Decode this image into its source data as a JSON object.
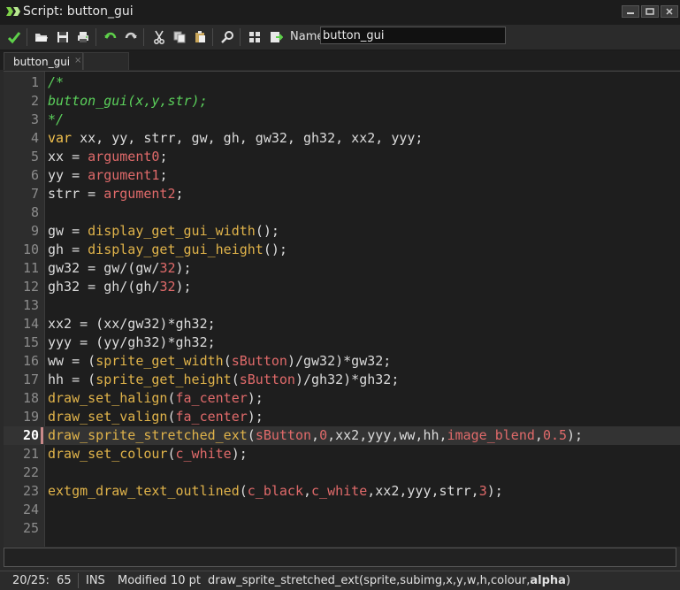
{
  "window": {
    "title": "Script: button_gui"
  },
  "toolbar": {
    "name_label": "Name",
    "name_value": "button_gui",
    "buttons": [
      "check-icon",
      "open-icon",
      "save-icon",
      "print-icon",
      "undo-icon",
      "redo-icon",
      "cut-icon",
      "copy-icon",
      "paste-icon",
      "find-icon",
      "goto-icon",
      "export-icon"
    ]
  },
  "tabs": [
    {
      "label": "button_gui",
      "close": "×"
    }
  ],
  "editor": {
    "current_line": 20,
    "lines": [
      {
        "n": "1",
        "tokens": [
          [
            "c",
            "/*"
          ]
        ]
      },
      {
        "n": "2",
        "tokens": [
          [
            "c",
            "button_gui(x,y,str);"
          ]
        ]
      },
      {
        "n": "3",
        "tokens": [
          [
            "c",
            "*/"
          ]
        ]
      },
      {
        "n": "4",
        "tokens": [
          [
            "k",
            "var"
          ],
          [
            "d",
            " xx, yy, strr, gw, gh, gw32, gh32, xx2, yyy;"
          ]
        ]
      },
      {
        "n": "5",
        "tokens": [
          [
            "d",
            "xx = "
          ],
          [
            "a",
            "argument0"
          ],
          [
            "d",
            ";"
          ]
        ]
      },
      {
        "n": "6",
        "tokens": [
          [
            "d",
            "yy = "
          ],
          [
            "a",
            "argument1"
          ],
          [
            "d",
            ";"
          ]
        ]
      },
      {
        "n": "7",
        "tokens": [
          [
            "d",
            "strr = "
          ],
          [
            "a",
            "argument2"
          ],
          [
            "d",
            ";"
          ]
        ]
      },
      {
        "n": "8",
        "tokens": []
      },
      {
        "n": "9",
        "tokens": [
          [
            "d",
            "gw = "
          ],
          [
            "f",
            "display_get_gui_width"
          ],
          [
            "d",
            "();"
          ]
        ]
      },
      {
        "n": "10",
        "tokens": [
          [
            "d",
            "gh = "
          ],
          [
            "f",
            "display_get_gui_height"
          ],
          [
            "d",
            "();"
          ]
        ]
      },
      {
        "n": "11",
        "tokens": [
          [
            "d",
            "gw32 = gw/(gw/"
          ],
          [
            "a",
            "32"
          ],
          [
            "d",
            ");"
          ]
        ]
      },
      {
        "n": "12",
        "tokens": [
          [
            "d",
            "gh32 = gh/(gh/"
          ],
          [
            "a",
            "32"
          ],
          [
            "d",
            ");"
          ]
        ]
      },
      {
        "n": "13",
        "tokens": []
      },
      {
        "n": "14",
        "tokens": [
          [
            "d",
            "xx2 = (xx/gw32)*gh32;"
          ]
        ]
      },
      {
        "n": "15",
        "tokens": [
          [
            "d",
            "yyy = (yy/gh32)*gh32;"
          ]
        ]
      },
      {
        "n": "16",
        "tokens": [
          [
            "d",
            "ww = ("
          ],
          [
            "f",
            "sprite_get_width"
          ],
          [
            "d",
            "("
          ],
          [
            "a",
            "sButton"
          ],
          [
            "d",
            ")/gw32)*gw32;"
          ]
        ]
      },
      {
        "n": "17",
        "tokens": [
          [
            "d",
            "hh = ("
          ],
          [
            "f",
            "sprite_get_height"
          ],
          [
            "d",
            "("
          ],
          [
            "a",
            "sButton"
          ],
          [
            "d",
            ")/gh32)*gh32;"
          ]
        ]
      },
      {
        "n": "18",
        "tokens": [
          [
            "f",
            "draw_set_halign"
          ],
          [
            "d",
            "("
          ],
          [
            "a",
            "fa_center"
          ],
          [
            "d",
            ");"
          ]
        ]
      },
      {
        "n": "19",
        "tokens": [
          [
            "f",
            "draw_set_valign"
          ],
          [
            "d",
            "("
          ],
          [
            "a",
            "fa_center"
          ],
          [
            "d",
            ");"
          ]
        ]
      },
      {
        "n": "20",
        "tokens": [
          [
            "f",
            "draw_sprite_stretched_ext"
          ],
          [
            "d",
            "("
          ],
          [
            "a",
            "sButton"
          ],
          [
            "d",
            ","
          ],
          [
            "a",
            "0"
          ],
          [
            "d",
            ",xx2,yyy,ww,hh,"
          ],
          [
            "a",
            "image_blend"
          ],
          [
            "d",
            ","
          ],
          [
            "a",
            "0.5"
          ],
          [
            "d",
            ");"
          ]
        ]
      },
      {
        "n": "21",
        "tokens": [
          [
            "f",
            "draw_set_colour"
          ],
          [
            "d",
            "("
          ],
          [
            "a",
            "c_white"
          ],
          [
            "d",
            ");"
          ]
        ]
      },
      {
        "n": "22",
        "tokens": []
      },
      {
        "n": "23",
        "tokens": [
          [
            "f",
            "extgm_draw_text_outlined"
          ],
          [
            "d",
            "("
          ],
          [
            "a",
            "c_black"
          ],
          [
            "d",
            ","
          ],
          [
            "a",
            "c_white"
          ],
          [
            "d",
            ",xx2,yyy,strr,"
          ],
          [
            "a",
            "3"
          ],
          [
            "d",
            ");"
          ]
        ]
      },
      {
        "n": "24",
        "tokens": []
      },
      {
        "n": "25",
        "tokens": []
      }
    ]
  },
  "status": {
    "position": "20/25:  65",
    "mode": "INS",
    "modified": "Modified",
    "font": "10 pt",
    "signature_prefix": "draw_sprite_stretched_ext(sprite,subimg,x,y,w,h,colour,",
    "signature_bold": "alpha",
    "signature_suffix": ")"
  },
  "colors": {
    "comment": "#5bd05b",
    "keyword": "#f2c14e",
    "function": "#e0b34a",
    "argument": "#e06a6a",
    "default": "#dcdcdc"
  }
}
